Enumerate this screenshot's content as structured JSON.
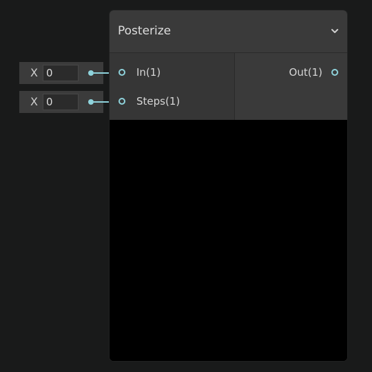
{
  "node": {
    "title": "Posterize",
    "collapse_icon": "chevron-down-icon",
    "inputs": [
      {
        "label": "In(1)",
        "external_axis": "X",
        "external_value": "0"
      },
      {
        "label": "Steps(1)",
        "external_axis": "X",
        "external_value": "0"
      }
    ],
    "outputs": [
      {
        "label": "Out(1)"
      }
    ]
  },
  "colors": {
    "background": "#191a1a",
    "node_header": "#3a3a3a",
    "port_accent": "#8fd3dc",
    "preview": "#000000"
  }
}
